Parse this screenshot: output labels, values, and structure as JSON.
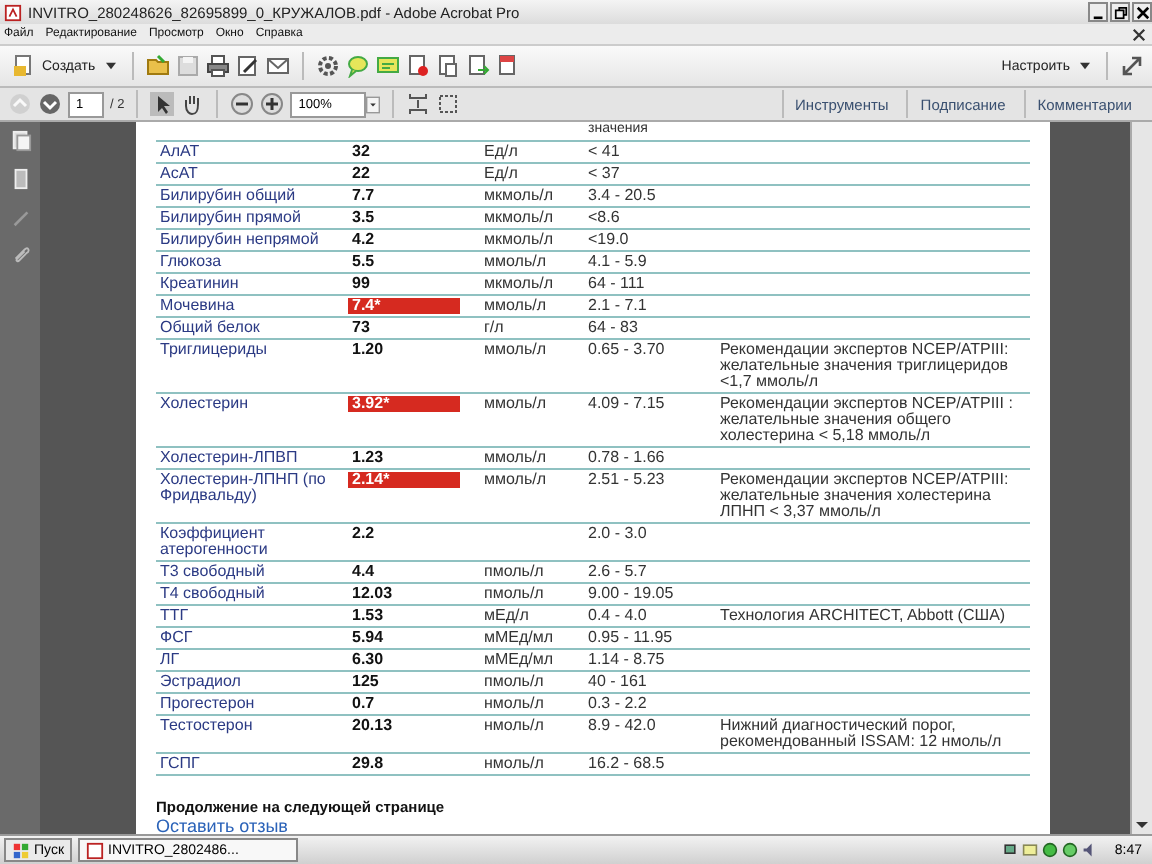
{
  "window": {
    "title": "INVITRO_280248626_82695899_0_КРУЖАЛОВ.pdf - Adobe Acrobat Pro"
  },
  "menu": [
    "Файл",
    "Редактирование",
    "Просмотр",
    "Окно",
    "Справка"
  ],
  "toolbar": {
    "create": "Создать",
    "customize": "Настроить"
  },
  "nav": {
    "page": "1",
    "page_count": "/ 2",
    "zoom": "100%"
  },
  "panels": [
    "Инструменты",
    "Подписание",
    "Комментарии"
  ],
  "report": {
    "header_cut": "значения",
    "rows": [
      {
        "name": "АлАТ",
        "value": "32",
        "flagged": false,
        "unit": "Ед/л",
        "reference": "< 41"
      },
      {
        "name": "АсАТ",
        "value": "22",
        "flagged": false,
        "unit": "Ед/л",
        "reference": "< 37"
      },
      {
        "name": "Билирубин общий",
        "value": "7.7",
        "flagged": false,
        "unit": "мкмоль/л",
        "reference": "3.4 - 20.5"
      },
      {
        "name": "Билирубин прямой",
        "value": "3.5",
        "flagged": false,
        "unit": "мкмоль/л",
        "reference": "<8.6"
      },
      {
        "name": "Билирубин непрямой",
        "value": "4.2",
        "flagged": false,
        "unit": "мкмоль/л",
        "reference": "<19.0"
      },
      {
        "name": "Глюкоза",
        "value": "5.5",
        "flagged": false,
        "unit": "ммоль/л",
        "reference": "4.1 - 5.9"
      },
      {
        "name": "Креатинин",
        "value": "99",
        "flagged": false,
        "unit": "мкмоль/л",
        "reference": "64 - 111"
      },
      {
        "name": "Мочевина",
        "value": "7.4*",
        "flagged": true,
        "unit": "ммоль/л",
        "reference": "2.1 - 7.1"
      },
      {
        "name": "Общий белок",
        "value": "73",
        "flagged": false,
        "unit": "г/л",
        "reference": "64 - 83"
      },
      {
        "name": "Триглицериды",
        "value": "1.20",
        "flagged": false,
        "unit": "ммоль/л",
        "reference": "0.65 - 3.70",
        "comment": "Рекомендации экспертов NCEP/ATPIII: желательные значения триглицеридов <1,7 ммоль/л"
      },
      {
        "name": "Холестерин",
        "value": "3.92*",
        "flagged": true,
        "unit": "ммоль/л",
        "reference": "4.09 - 7.15",
        "comment": "Рекомендации экспертов NCEP/ATPIII : желательные значения общего холестерина < 5,18 ммоль/л"
      },
      {
        "name": "Холестерин-ЛПВП",
        "value": "1.23",
        "flagged": false,
        "unit": "ммоль/л",
        "reference": "0.78 - 1.66"
      },
      {
        "name": "Холестерин-ЛПНП (по Фридвальду)",
        "value": "2.14*",
        "flagged": true,
        "unit": "ммоль/л",
        "reference": "2.51 - 5.23",
        "comment": "Рекомендации экспертов NCEP/ATPIII: желательные значения холестерина ЛПНП < 3,37 ммоль/л"
      },
      {
        "name": "Коэффициент атерогенности",
        "value": "2.2",
        "flagged": false,
        "reference": "2.0 - 3.0"
      },
      {
        "name": "Т3 свободный",
        "value": "4.4",
        "flagged": false,
        "unit": "пмоль/л",
        "reference": "2.6 - 5.7"
      },
      {
        "name": "Т4 свободный",
        "value": "12.03",
        "flagged": false,
        "unit": "пмоль/л",
        "reference": "9.00 - 19.05"
      },
      {
        "name": "ТТГ",
        "value": "1.53",
        "flagged": false,
        "unit": "мЕд/л",
        "reference": "0.4 - 4.0",
        "comment": "Технология ARCHITECT, Abbott (США)"
      },
      {
        "name": "ФСГ",
        "value": "5.94",
        "flagged": false,
        "unit": "мМЕд/мл",
        "reference": "0.95 - 11.95"
      },
      {
        "name": "ЛГ",
        "value": "6.30",
        "flagged": false,
        "unit": "мМЕд/мл",
        "reference": "1.14 - 8.75"
      },
      {
        "name": "Эстрадиол",
        "value": "125",
        "flagged": false,
        "unit": "пмоль/л",
        "reference": "40 - 161"
      },
      {
        "name": "Прогестерон",
        "value": "0.7",
        "flagged": false,
        "unit": "нмоль/л",
        "reference": "0.3 - 2.2"
      },
      {
        "name": "Тестостерон",
        "value": "20.13",
        "flagged": false,
        "unit": "нмоль/л",
        "reference": "8.9 - 42.0",
        "comment": "Нижний диагностический порог, рекомендованный ISSAM: 12 нмоль/л"
      },
      {
        "name": "ГСПГ",
        "value": "29.8",
        "flagged": false,
        "unit": "нмоль/л",
        "reference": "16.2 - 68.5"
      }
    ],
    "continued": "Продолжение на следующей странице",
    "feedback_link": "Оставить отзыв"
  },
  "taskbar": {
    "start": "Пуск",
    "tasks": [
      "INVITRO_2802486..."
    ],
    "time": "8:47"
  }
}
